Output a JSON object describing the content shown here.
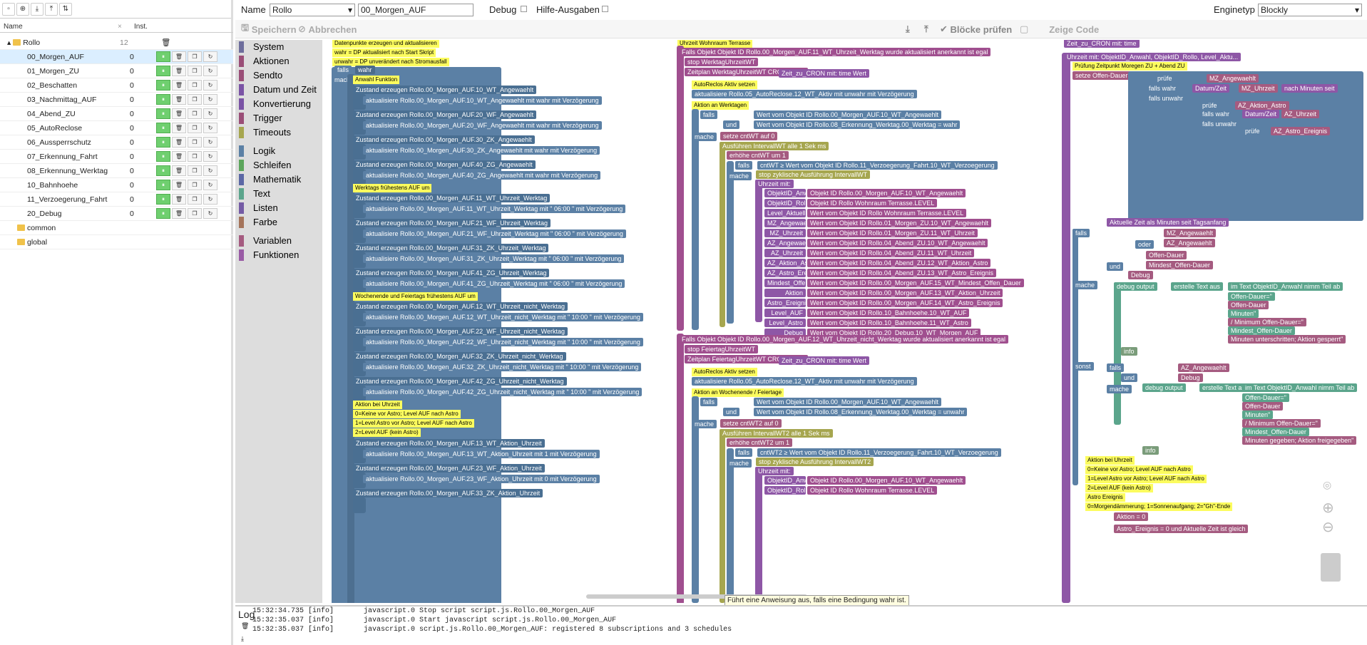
{
  "tree": {
    "header_name": "Name",
    "header_inst": "Inst.",
    "folder": "Rollo",
    "folder_count": "12",
    "items": [
      {
        "name": "00_Morgen_AUF",
        "inst": "0"
      },
      {
        "name": "01_Morgen_ZU",
        "inst": "0"
      },
      {
        "name": "02_Beschatten",
        "inst": "0"
      },
      {
        "name": "03_Nachmittag_AUF",
        "inst": "0"
      },
      {
        "name": "04_Abend_ZU",
        "inst": "0"
      },
      {
        "name": "05_AutoReclose",
        "inst": "0"
      },
      {
        "name": "06_Aussperrschutz",
        "inst": "0"
      },
      {
        "name": "07_Erkennung_Fahrt",
        "inst": "0"
      },
      {
        "name": "08_Erkennung_Werktag",
        "inst": "0"
      },
      {
        "name": "10_Bahnhoehe",
        "inst": "0"
      },
      {
        "name": "11_Verzoegerung_Fahrt",
        "inst": "0"
      },
      {
        "name": "20_Debug",
        "inst": "0"
      }
    ],
    "other_folders": [
      "common",
      "global"
    ]
  },
  "toolbar": {
    "name_label": "Name",
    "folder_value": "Rollo",
    "script_name": "00_Morgen_AUF",
    "debug_label": "Debug",
    "hilfe_label": "Hilfe-Ausgaben",
    "enginetyp_label": "Enginetyp",
    "engine_value": "Blockly",
    "save_label": "Speichern",
    "discard_label": "Abbrechen",
    "check_label": "Blöcke prüfen",
    "code_label": "Zeige Code"
  },
  "categories": [
    {
      "label": "System",
      "color": "#6d6d9c"
    },
    {
      "label": "Aktionen",
      "color": "#9a4e77"
    },
    {
      "label": "Sendto",
      "color": "#9a4e77"
    },
    {
      "label": "Datum und Zeit",
      "color": "#7a53a5"
    },
    {
      "label": "Konvertierung",
      "color": "#7a53a5"
    },
    {
      "label": "Trigger",
      "color": "#9a4e77"
    },
    {
      "label": "Timeouts",
      "color": "#a6a64f"
    },
    {
      "label": "Logik",
      "color": "#5b80a5"
    },
    {
      "label": "Schleifen",
      "color": "#5ba55b"
    },
    {
      "label": "Mathematik",
      "color": "#5b67a5"
    },
    {
      "label": "Text",
      "color": "#5ba58c"
    },
    {
      "label": "Listen",
      "color": "#745ba5"
    },
    {
      "label": "Farbe",
      "color": "#a5745b"
    },
    {
      "label": "Variablen",
      "color": "#a55b80"
    },
    {
      "label": "Funktionen",
      "color": "#995ba5"
    }
  ],
  "blocks": {
    "c1_comments": [
      "Datenpunkte erzeugen und aktualisieren",
      "wahr = DP aktualisiert nach Start Skript",
      "unwahr = DP unverändert nach Stromausfall"
    ],
    "c1_falls": "falls",
    "c1_wahr": "wahr",
    "c1_mache": "mache",
    "c1_anwahl": "Anwahl Funktion",
    "c1_zustand": [
      "Zustand erzeugen  Rollo.00_Morgen_AUF.10_WT_Angewaehlt",
      "Zustand erzeugen  Rollo.00_Morgen_AUF.20_WF_Angewaehlt",
      "Zustand erzeugen  Rollo.00_Morgen_AUF.30_ZK_Angewaehlt",
      "Zustand erzeugen  Rollo.00_Morgen_AUF.40_ZG_Angewaehlt"
    ],
    "c1_aktual": [
      "aktualisiere  Rollo.00_Morgen_AUF.10_WT_Angewaehlt  mit  wahr  mit Verzögerung",
      "aktualisiere  Rollo.00_Morgen_AUF.20_WF_Angewaehlt  mit  wahr  mit Verzögerung",
      "aktualisiere  Rollo.00_Morgen_AUF.30_ZK_Angewaehlt  mit  wahr  mit Verzögerung",
      "aktualisiere  Rollo.00_Morgen_AUF.40_ZG_Angewaehlt  mit  wahr  mit Verzögerung"
    ],
    "c1_werktag": "Werktags frühestens AUF um",
    "c1_zustand2": [
      "Zustand erzeugen  Rollo.00_Morgen_AUF.11_WT_Uhrzeit_Werktag",
      "Zustand erzeugen  Rollo.00_Morgen_AUF.21_WF_Uhrzeit_Werktag",
      "Zustand erzeugen  Rollo.00_Morgen_AUF.31_ZK_Uhrzeit_Werktag",
      "Zustand erzeugen  Rollo.00_Morgen_AUF.41_ZG_Uhrzeit_Werktag"
    ],
    "c1_aktual2": [
      "aktualisiere  Rollo.00_Morgen_AUF.11_WT_Uhrzeit_Werktag  mit  \" 06:00 \"  mit Verzögerung",
      "aktualisiere  Rollo.00_Morgen_AUF.21_WF_Uhrzeit_Werktag  mit  \" 06:00 \"  mit Verzögerung",
      "aktualisiere  Rollo.00_Morgen_AUF.31_ZK_Uhrzeit_Werktag  mit  \" 06:00 \"  mit Verzögerung",
      "aktualisiere  Rollo.00_Morgen_AUF.41_ZG_Uhrzeit_Werktag  mit  \" 06:00 \"  mit Verzögerung"
    ],
    "c1_wochenende": "Wochenende und Feiertags frühestens AUF um",
    "c1_zustand3": [
      "Zustand erzeugen  Rollo.00_Morgen_AUF.12_WT_Uhrzeit_nicht_Werktag",
      "Zustand erzeugen  Rollo.00_Morgen_AUF.22_WF_Uhrzeit_nicht_Werktag",
      "Zustand erzeugen  Rollo.00_Morgen_AUF.32_ZK_Uhrzeit_nicht_Werktag",
      "Zustand erzeugen  Rollo.00_Morgen_AUF.42_ZG_Uhrzeit_nicht_Werktag"
    ],
    "c1_aktual3": [
      "aktualisiere  Rollo.00_Morgen_AUF.12_WT_Uhrzeit_nicht_Werktag  mit  \" 10:00 \"  mit Verzögerung",
      "aktualisiere  Rollo.00_Morgen_AUF.22_WF_Uhrzeit_nicht_Werktag  mit  \" 10:00 \"  mit Verzögerung",
      "aktualisiere  Rollo.00_Morgen_AUF.32_ZK_Uhrzeit_nicht_Werktag  mit  \" 10:00 \"  mit Verzögerung",
      "aktualisiere  Rollo.00_Morgen_AUF.42_ZG_Uhrzeit_nicht_Werktag  mit  \" 10:00 \"  mit Verzögerung"
    ],
    "c1_aktion_comments": [
      "Aktion bei Uhrzeit",
      "0=Keine vor Astro; Level AUF nach Astro",
      "1=Level Astro vor Astro; Level AUF nach Astro",
      "2=Level AUF (kein Astro)"
    ],
    "c1_zustand4": [
      "Zustand erzeugen  Rollo.00_Morgen_AUF.13_WT_Aktion_Uhrzeit",
      "Zustand erzeugen  Rollo.00_Morgen_AUF.23_WF_Aktion_Uhrzeit",
      "Zustand erzeugen  Rollo.00_Morgen_AUF.33_ZK_Aktion_Uhrzeit"
    ],
    "c1_aktual4": [
      "aktualisiere  Rollo.00_Morgen_AUF.13_WT_Aktion_Uhrzeit  mit  1  mit Verzögerung",
      "aktualisiere  Rollo.00_Morgen_AUF.23_WF_Aktion_Uhrzeit  mit  0  mit Verzögerung"
    ],
    "c2_title": "Uhrzeit Wohnraum Terrasse",
    "c2_falls_objekt": "Falls Objekt  Objekt ID  Rollo.00_Morgen_AUF.11_WT_Uhrzeit_Werktag  wurde aktualisiert  anerkannt ist  egal",
    "c2_stop": "stop  WerktagUhrzeitWT",
    "c2_zeitplan": "Zeitplan  WerktagUhrzeitWT  CRON Regel",
    "c2_cron": "Zeit_zu_CRON  mit:  time  Wert",
    "c2_autoreclose": "AutoReclos Aktiv setzen",
    "c2_aktual": "aktualisiere  Rollo.05_AutoReclose.12_WT_Aktiv  mit  unwahr  mit Verzögerung",
    "c2_aktion": "Aktion an Werktagen",
    "c2_falls": "falls",
    "c2_cond1": "Wert  vom Objekt ID  Rollo.00_Morgen_AUF.10_WT_Angewaehlt",
    "c2_cond2": "Wert  vom Objekt ID  Rollo.08_Erkennung_Werktag.00_Werktag  =  wahr",
    "c2_und": "und",
    "c2_mache": "mache",
    "c2_setze": "setze  cntWT  auf  0",
    "c2_ausfuehren": "Ausführen  IntervallWT  alle  1  Sek  ms",
    "c2_erhoehe": "erhöhe  cntWT  um  1",
    "c2_falls2": "cntWT  ≥  Wert  vom Objekt ID  Rollo.11_Verzoegerung_Fahrt.10_WT_Verzoegerung",
    "c2_stopzyk": "stop zyklische Ausführung  IntervallWT",
    "c2_uhrzeit": "Uhrzeit  mit:",
    "c2_params": [
      [
        "ObjektID_Anwahl",
        "Objekt ID  Rollo.00_Morgen_AUF.10_WT_Angewaehlt"
      ],
      [
        "ObjektID_Rollo",
        "Objekt ID  Rollo Wohnraum Terrasse.LEVEL"
      ],
      [
        "Level_Aktuell",
        "Wert  vom Objekt ID  Rollo Wohnraum Terrasse.LEVEL"
      ],
      [
        "MZ_Angewaehlt",
        "Wert  vom Objekt ID  Rollo.01_Morgen_ZU.10_WT_Angewaehlt"
      ],
      [
        "MZ_Uhrzeit",
        "Wert  vom Objekt ID  Rollo.01_Morgen_ZU.11_WT_Uhrzeit"
      ],
      [
        "AZ_Angewaehlt",
        "Wert  vom Objekt ID  Rollo.04_Abend_ZU.10_WT_Angewaehlt"
      ],
      [
        "AZ_Uhrzeit",
        "Wert  vom Objekt ID  Rollo.04_Abend_ZU.11_WT_Uhrzeit"
      ],
      [
        "AZ_Aktion_Astro",
        "Wert  vom Objekt ID  Rollo.04_Abend_ZU.12_WT_Aktion_Astro"
      ],
      [
        "AZ_Astro_Ereignis",
        "Wert  vom Objekt ID  Rollo.04_Abend_ZU.13_WT_Astro_Ereignis"
      ],
      [
        "Mindest_Offen-Dauer",
        "Wert  vom Objekt ID  Rollo.00_Morgen_AUF.15_WT_Mindest_Offen_Dauer"
      ],
      [
        "Aktion",
        "Wert  vom Objekt ID  Rollo.00_Morgen_AUF.13_WT_Aktion_Uhrzeit"
      ],
      [
        "Astro_Ereignis",
        "Wert  vom Objekt ID  Rollo.00_Morgen_AUF.14_WT_Astro_Ereignis"
      ],
      [
        "Level_AUF",
        "Wert  vom Objekt ID  Rollo.10_Bahnhoehe.10_WT_AUF"
      ],
      [
        "Level_Astro",
        "Wert  vom Objekt ID  Rollo.10_Bahnhoehe.11_WT_Astro"
      ],
      [
        "Debug",
        "Wert  vom Objekt ID  Rollo.20_Debug.10_WT_Morgen_AUF"
      ]
    ],
    "c2b_falls_objekt": "Falls Objekt  Objekt ID  Rollo.00_Morgen_AUF.12_WT_Uhrzeit_nicht_Werktag  wurde aktualisiert  anerkannt ist  egal",
    "c2b_stop": "stop  FeiertagUhrzeitWT",
    "c2b_zeitplan": "Zeitplan  FeiertagUhrzeitWT  CRON Regel",
    "c2b_cron": "Zeit_zu_CRON  mit:  time  Wert",
    "c2b_autoreclose": "AutoReclos Aktiv setzen",
    "c2b_aktual": "aktualisiere  Rollo.05_AutoReclose.12_WT_Aktiv  mit  unwahr  mit Verzögerung",
    "c2b_aktion": "Aktion an Wochenende / Feiertage",
    "c2b_cond1": "Wert  vom Objekt ID  Rollo.00_Morgen_AUF.10_WT_Angewaehlt",
    "c2b_cond2": "Wert  vom Objekt ID  Rollo.08_Erkennung_Werktag.00_Werktag  =  unwahr",
    "c2b_setze": "setze  cntWT2  auf  0",
    "c2b_ausfuehren": "Ausführen  IntervallWT2  alle  1  Sek  ms",
    "c2b_erhoehe": "erhöhe  cntWT2  um  1",
    "c2b_falls2": "cntWT2  ≥  Wert  vom Objekt ID  Rollo.11_Verzoegerung_Fahrt.10_WT_Verzoegerung",
    "c2b_stopzyk": "stop zyklische Ausführung  IntervallWT2",
    "c2b_params": [
      [
        "ObjektID_Anwahl",
        "Objekt ID  Rollo.00_Morgen_AUF.10_WT_Angewaehlt"
      ],
      [
        "ObjektID_Rollo",
        "Objekt ID  Rollo Wohnraum Terrasse.LEVEL"
      ]
    ],
    "c3_top": "Zeit_zu_CRON  mit:  time",
    "c3_uhrzeit": "Uhrzeit  mit: ObjektID_Anwahl, ObjektID_Rollo, Level_Aktu...",
    "c3_pruefung": "Prüfung Zeitpunkt Moregen ZU + Abend ZU",
    "c3_setze": "setze  Offen-Dauer  auf",
    "c3_pruefe": "prüfe",
    "c3_falls_wahr": "falls wahr",
    "c3_falls_unwahr": "falls unwahr",
    "c3_mz": "MZ_Angewaehlt",
    "c3_datumzeit": "Datum/Zeit",
    "c3_mzuhr": "MZ_Uhrzeit",
    "c3_nach": "nach  Minuten seit",
    "c3_az": "AZ_Aktion_Astro",
    "c3_azuhr": "AZ_Uhrzeit",
    "c3_azast": "AZ_Astro_Ereignis",
    "c3_aktuell": "Aktuelle Zeit als  Minuten seit Tagsanfang",
    "c3_falls": "falls",
    "c3_oder": "oder",
    "c3_und": "und",
    "c3_mache": "mache",
    "c3_sonst": "sonst",
    "c3_debug": "debug output",
    "c3_erstelle": "erstelle Text aus",
    "c3_im_text": "im Text  ObjektID_Anwahl  nimm Teil ab",
    "c3_texts": [
      "Offen-Dauer=\"",
      "Offen-Dauer",
      "Minuten\"",
      "/ Minimum Offen-Dauer=\"",
      "Mindest_Offen-Dauer",
      "Minuten unterschritten; Aktion gesperrt\""
    ],
    "c3_texts2": [
      "Offen-Dauer=\"",
      "Offen-Dauer",
      "Minuten\"",
      "/ Minimum Offen-Dauer=\"",
      "Mindest_Offen-Dauer",
      "Minuten gegeben; Aktion freigegeben\""
    ],
    "c3_info": "info",
    "c3_mindest": "Mindest_Offen-Dauer",
    "c3_offen": "Offen-Dauer",
    "c3_debug_var": "Debug",
    "c3_comments": [
      "Aktion bei Uhrzeit",
      "0=Keine vor Astro; Level AUF nach Astro",
      "1=Level Astro vor Astro; Level AUF nach Astro",
      "2=Level AUF (kein Astro)",
      "Astro Ereignis",
      "0=Morgendämmerung; 1=Sonnenaufgang; 2=\"Gh\"-Ende"
    ],
    "c3_aktion": "Aktion  =  0",
    "c3_astro": "Astro_Ereignis  =  0  und  Aktuelle Zeit  ist  gleich"
  },
  "tooltip": "Führt eine Anweisung aus, falls eine Bedingung wahr ist.",
  "log": {
    "label": "Log",
    "lines": [
      {
        "time": "15:32:34.735",
        "level": "[info]",
        "msg": "javascript.0 Stop script script.js.Rollo.00_Morgen_AUF"
      },
      {
        "time": "15:32:35.037",
        "level": "[info]",
        "msg": "javascript.0 Start javascript script.js.Rollo.00_Morgen_AUF"
      },
      {
        "time": "15:32:35.037",
        "level": "[info]",
        "msg": "javascript.0 script.js.Rollo.00_Morgen_AUF: registered 8 subscriptions and 3 schedules"
      }
    ]
  }
}
